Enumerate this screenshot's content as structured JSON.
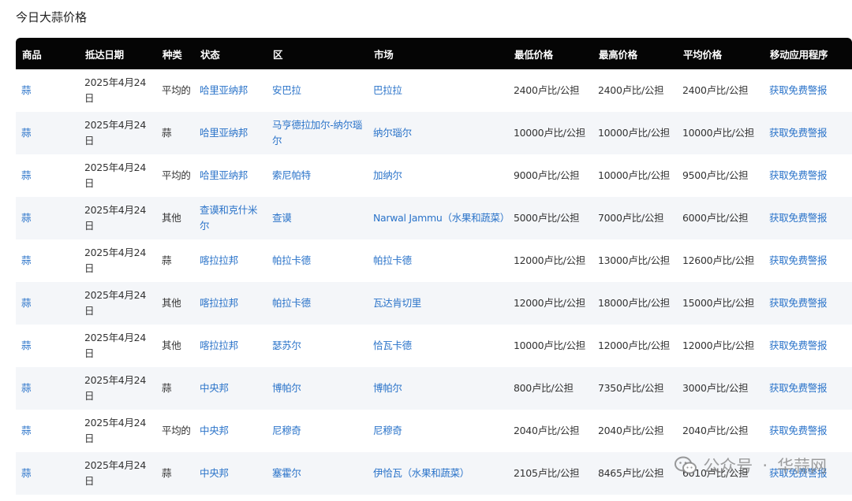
{
  "page": {
    "title": "今日大蒜价格"
  },
  "table": {
    "headers": [
      "商品",
      "抵达日期",
      "种类",
      "状态",
      "区",
      "市场",
      "最低价格",
      "最高价格",
      "平均价格",
      "移动应用程序"
    ],
    "rows": [
      [
        "蒜",
        "2025年4月24日",
        "平均的",
        "哈里亚纳邦",
        "安巴拉",
        "巴拉拉",
        "2400卢比/公担",
        "2400卢比/公担",
        "2400卢比/公担",
        "获取免费警报"
      ],
      [
        "蒜",
        "2025年4月24日",
        "蒜",
        "哈里亚纳邦",
        "马亨德拉加尔-纳尔瑙尔",
        "纳尔瑙尔",
        "10000卢比/公担",
        "10000卢比/公担",
        "10000卢比/公担",
        "获取免费警报"
      ],
      [
        "蒜",
        "2025年4月24日",
        "平均的",
        "哈里亚纳邦",
        "索尼帕特",
        "加纳尔",
        "9000卢比/公担",
        "10000卢比/公担",
        "9500卢比/公担",
        "获取免费警报"
      ],
      [
        "蒜",
        "2025年4月24日",
        "其他",
        "查谟和克什米尔",
        "查谟",
        "Narwal Jammu（水果和蔬菜）",
        "5000卢比/公担",
        "7000卢比/公担",
        "6000卢比/公担",
        "获取免费警报"
      ],
      [
        "蒜",
        "2025年4月24日",
        "蒜",
        "喀拉拉邦",
        "帕拉卡德",
        "帕拉卡德",
        "12000卢比/公担",
        "13000卢比/公担",
        "12600卢比/公担",
        "获取免费警报"
      ],
      [
        "蒜",
        "2025年4月24日",
        "其他",
        "喀拉拉邦",
        "帕拉卡德",
        "瓦达肯切里",
        "12000卢比/公担",
        "18000卢比/公担",
        "15000卢比/公担",
        "获取免费警报"
      ],
      [
        "蒜",
        "2025年4月24日",
        "其他",
        "喀拉拉邦",
        "瑟苏尔",
        "恰瓦卡德",
        "10000卢比/公担",
        "12000卢比/公担",
        "12000卢比/公担",
        "获取免费警报"
      ],
      [
        "蒜",
        "2025年4月24日",
        "蒜",
        "中央邦",
        "博帕尔",
        "博帕尔",
        "800卢比/公担",
        "7350卢比/公担",
        "3000卢比/公担",
        "获取免费警报"
      ],
      [
        "蒜",
        "2025年4月24日",
        "平均的",
        "中央邦",
        "尼穆奇",
        "尼穆奇",
        "2040卢比/公担",
        "2040卢比/公担",
        "2040卢比/公担",
        "获取免费警报"
      ],
      [
        "蒜",
        "2025年4月24日",
        "蒜",
        "中央邦",
        "塞霍尔",
        "伊恰瓦（水果和蔬菜）",
        "2105卢比/公担",
        "8465卢比/公担",
        "6010卢比/公担",
        "获取免费警报"
      ]
    ]
  },
  "watermark": {
    "text_left": "公众号",
    "separator": "·",
    "text_right": "华蒜网",
    "icon": "wechat-icon"
  },
  "colors": {
    "header_bg": "#050505",
    "link": "#2a73c9",
    "stripe": "#f4f6f9"
  }
}
